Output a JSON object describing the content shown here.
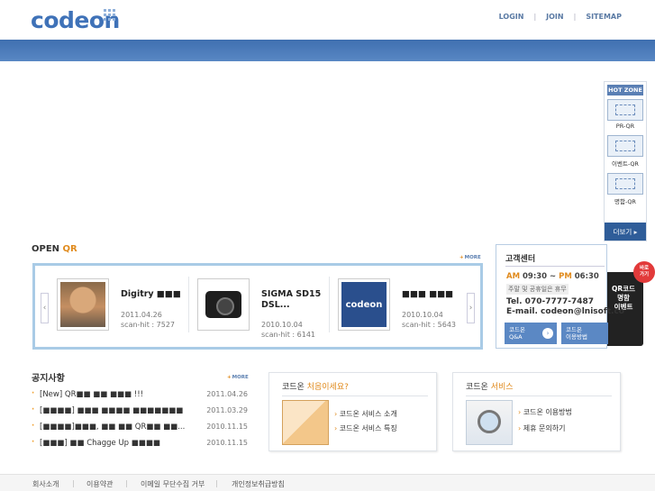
{
  "header": {
    "logo": "codeon",
    "links": [
      "LOGIN",
      "JOIN",
      "SITEMAP"
    ]
  },
  "hotzone": {
    "title": "HOT ZONE",
    "items": [
      "PR-QR",
      "이벤트-QR",
      "명함-QR"
    ],
    "more": "더보기 ▸"
  },
  "promo": {
    "badge": "바로\n가기",
    "text": "QR코드\n명함\n이벤트"
  },
  "open_qr": {
    "title_prefix": "OPEN",
    "title_qr": "QR",
    "more": "MORE",
    "cards": [
      {
        "title": "Digitry ■■■",
        "date": "2011.04.26",
        "hit": "scan-hit : 7527",
        "thumb": "person-photo"
      },
      {
        "title": "SIGMA SD15 DSL...",
        "date": "2010.10.04",
        "hit": "scan-hit : 6141",
        "thumb": "camera-photo"
      },
      {
        "title": "■■■ ■■■",
        "date": "2010.10.04",
        "hit": "scan-hit : 5643",
        "thumb": "codeon-logo"
      }
    ]
  },
  "customer": {
    "title": "고객센터",
    "am": "AM",
    "am_time": " 09:30 ~ ",
    "pm": "PM",
    "pm_time": " 06:30",
    "note": "주말 및 공휴일은 휴무",
    "tel": "Tel.      070-7777-7487",
    "mail": "E-mail. codeon@lnisoft.co",
    "buttons": [
      {
        "line1": "코드온",
        "line2": "Q&A"
      },
      {
        "line1": "코드온",
        "line2": "이용방법"
      }
    ]
  },
  "notice": {
    "title": "공지사항",
    "more": "MORE",
    "items": [
      {
        "text": "[New] QR■■ ■■ ■■■ !!!",
        "date": "2011.04.26"
      },
      {
        "text": "[■■■■] ■■■ ■■■■ ■■■■■■■",
        "date": "2011.03.29"
      },
      {
        "text": "[■■■■]■■■, ■■ ■■ QR■■ ■■...",
        "date": "2010.11.15"
      },
      {
        "text": "[■■■] ■■ Chagge Up ■■■■",
        "date": "2010.11.15"
      }
    ]
  },
  "box_first": {
    "title_prefix": "코드온 ",
    "title_highlight": "처음이세요?",
    "links": [
      "코드온 서비스 소개",
      "코드온 서비스 특징"
    ]
  },
  "box_service": {
    "title_prefix": "코드온 ",
    "title_highlight": "서비스",
    "links": [
      "코드온 이용방법",
      "제휴 문의하기"
    ]
  },
  "footer": {
    "links": [
      "회사소개",
      "이용약관",
      "이메일 무단수집 거부",
      "개인정보취급방침"
    ]
  },
  "colors": {
    "brand_blue": "#3f72b8",
    "accent_orange": "#e08a1c"
  }
}
